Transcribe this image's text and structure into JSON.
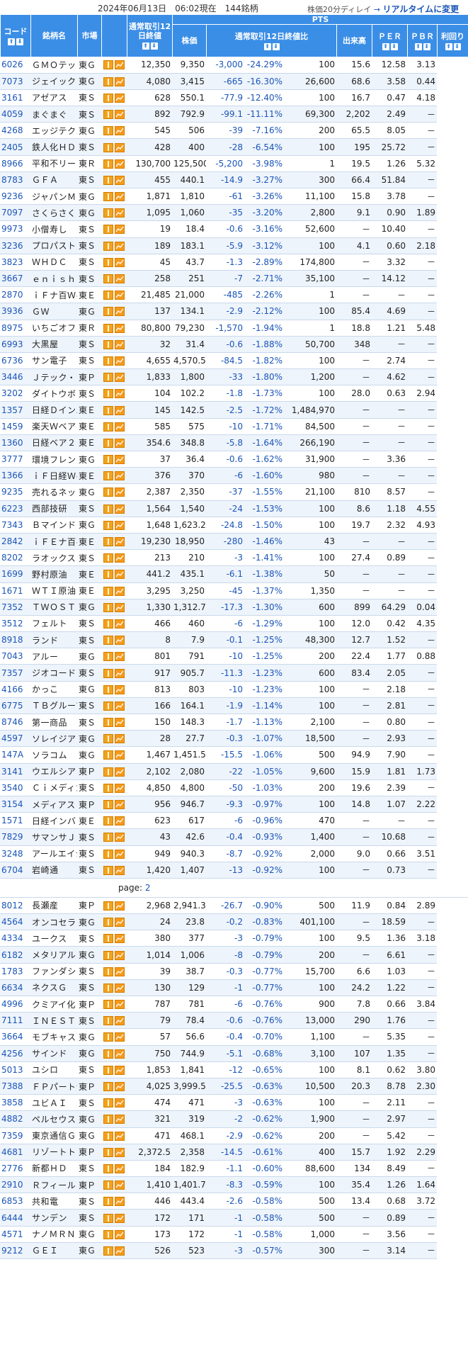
{
  "header": {
    "datetime": "2024年06月13日　06:02現在　144銘柄",
    "delay_text": "株価20分ディレイ",
    "arrow": "→",
    "realtime_link": "リアルタイムに変更"
  },
  "columns": {
    "code": "コード",
    "name": "銘柄名",
    "market": "市場",
    "close_label": "通常取引12日終値",
    "pts": "PTS",
    "price": "株価",
    "ratio_label": "通常取引12日終値比",
    "volume": "出来高",
    "per": "ＰＥＲ",
    "pbr": "ＰＢＲ",
    "yield": "利回り",
    "sort_up": "⬆",
    "sort_down": "⬇"
  },
  "page2_label": "page: ",
  "page2_link": "2",
  "rows": [
    [
      "6026",
      "ＧＭＯテック",
      "東Ｇ",
      "12,350",
      "9,350",
      "-3,000",
      "-24.29%",
      "100",
      "15.6",
      "12.58",
      "3.13"
    ],
    [
      "7073",
      "ジェイック",
      "東Ｇ",
      "4,080",
      "3,415",
      "-665",
      "-16.30%",
      "26,600",
      "68.6",
      "3.58",
      "0.44"
    ],
    [
      "3161",
      "アゼアス",
      "東Ｓ",
      "628",
      "550.1",
      "-77.9",
      "-12.40%",
      "100",
      "16.7",
      "0.47",
      "4.18"
    ],
    [
      "4059",
      "まぐまぐ",
      "東Ｓ",
      "892",
      "792.9",
      "-99.1",
      "-11.11%",
      "69,300",
      "2,202",
      "2.49",
      "－"
    ],
    [
      "4268",
      "エッジテクノ",
      "東Ｇ",
      "545",
      "506",
      "-39",
      "-7.16%",
      "200",
      "65.5",
      "8.05",
      "－"
    ],
    [
      "2405",
      "鉄人化ＨＤ",
      "東Ｓ",
      "428",
      "400",
      "-28",
      "-6.54%",
      "100",
      "195",
      "25.72",
      "－"
    ],
    [
      "8966",
      "平和不リート",
      "東Ｒ",
      "130,700",
      "125,500",
      "-5,200",
      "-3.98%",
      "1",
      "19.5",
      "1.26",
      "5.32"
    ],
    [
      "8783",
      "ＧＦＡ",
      "東Ｓ",
      "455",
      "440.1",
      "-14.9",
      "-3.27%",
      "300",
      "66.4",
      "51.84",
      "－"
    ],
    [
      "9236",
      "ジャパンＭＡ",
      "東Ｇ",
      "1,871",
      "1,810",
      "-61",
      "-3.26%",
      "11,100",
      "15.8",
      "3.78",
      "－"
    ],
    [
      "7097",
      "さくらさく",
      "東Ｇ",
      "1,095",
      "1,060",
      "-35",
      "-3.20%",
      "2,800",
      "9.1",
      "0.90",
      "1.89"
    ],
    [
      "9973",
      "小僧寿し",
      "東Ｓ",
      "19",
      "18.4",
      "-0.6",
      "-3.16%",
      "52,600",
      "－",
      "10.40",
      "－"
    ],
    [
      "3236",
      "プロパスト",
      "東Ｓ",
      "189",
      "183.1",
      "-5.9",
      "-3.12%",
      "100",
      "4.1",
      "0.60",
      "2.18"
    ],
    [
      "3823",
      "ＷＨＤＣ",
      "東Ｓ",
      "45",
      "43.7",
      "-1.3",
      "-2.89%",
      "174,800",
      "－",
      "3.32",
      "－"
    ],
    [
      "3667",
      "ｅｎｉｓｈ",
      "東Ｓ",
      "258",
      "251",
      "-7",
      "-2.71%",
      "35,100",
      "－",
      "14.12",
      "－"
    ],
    [
      "2870",
      "ｉＦナ百Ｗベ",
      "東Ｅ",
      "21,485",
      "21,000",
      "-485",
      "-2.26%",
      "1",
      "－",
      "－",
      "－"
    ],
    [
      "3936",
      "ＧＷ",
      "東Ｇ",
      "137",
      "134.1",
      "-2.9",
      "-2.12%",
      "100",
      "85.4",
      "4.69",
      "－"
    ],
    [
      "8975",
      "いちごオフィ",
      "東Ｒ",
      "80,800",
      "79,230",
      "-1,570",
      "-1.94%",
      "1",
      "18.8",
      "1.21",
      "5.48"
    ],
    [
      "6993",
      "大黒屋",
      "東Ｓ",
      "32",
      "31.4",
      "-0.6",
      "-1.88%",
      "50,700",
      "348",
      "－",
      "－"
    ],
    [
      "6736",
      "サン電子",
      "東Ｓ",
      "4,655",
      "4,570.5",
      "-84.5",
      "-1.82%",
      "100",
      "－",
      "2.74",
      "－"
    ],
    [
      "3446",
      "Ｊテック・Ｃ",
      "東Ｐ",
      "1,833",
      "1,800",
      "-33",
      "-1.80%",
      "1,200",
      "－",
      "4.62",
      "－"
    ],
    [
      "3202",
      "ダイトウボウ",
      "東Ｓ",
      "104",
      "102.2",
      "-1.8",
      "-1.73%",
      "100",
      "28.0",
      "0.63",
      "2.94"
    ],
    [
      "1357",
      "日経Ｄインバ",
      "東Ｅ",
      "145",
      "142.5",
      "-2.5",
      "-1.72%",
      "1,484,970",
      "－",
      "－",
      "－"
    ],
    [
      "1459",
      "楽天Ｗベア",
      "東Ｅ",
      "585",
      "575",
      "-10",
      "-1.71%",
      "84,500",
      "－",
      "－",
      "－"
    ],
    [
      "1360",
      "日経ベア２",
      "東Ｅ",
      "354.6",
      "348.8",
      "-5.8",
      "-1.64%",
      "266,190",
      "－",
      "－",
      "－"
    ],
    [
      "3777",
      "環境フレンド",
      "東Ｇ",
      "37",
      "36.4",
      "-0.6",
      "-1.62%",
      "31,900",
      "－",
      "3.36",
      "－"
    ],
    [
      "1366",
      "ｉＦ日経Ｗベ",
      "東Ｅ",
      "376",
      "370",
      "-6",
      "-1.60%",
      "980",
      "－",
      "－",
      "－"
    ],
    [
      "9235",
      "売れるネット",
      "東Ｇ",
      "2,387",
      "2,350",
      "-37",
      "-1.55%",
      "21,100",
      "810",
      "8.57",
      "－"
    ],
    [
      "6223",
      "西部技研",
      "東Ｓ",
      "1,564",
      "1,540",
      "-24",
      "-1.53%",
      "100",
      "8.6",
      "1.18",
      "4.55"
    ],
    [
      "7343",
      "Ｂマインド",
      "東Ｇ",
      "1,648",
      "1,623.2",
      "-24.8",
      "-1.50%",
      "100",
      "19.7",
      "2.32",
      "4.93"
    ],
    [
      "2842",
      "ｉＦＥナ百ベ",
      "東Ｅ",
      "19,230",
      "18,950",
      "-280",
      "-1.46%",
      "43",
      "－",
      "－",
      "－"
    ],
    [
      "8202",
      "ラオックス",
      "東Ｓ",
      "213",
      "210",
      "-3",
      "-1.41%",
      "100",
      "27.4",
      "0.89",
      "－"
    ],
    [
      "1699",
      "野村原油",
      "東Ｅ",
      "441.2",
      "435.1",
      "-6.1",
      "-1.38%",
      "50",
      "－",
      "－",
      "－"
    ],
    [
      "1671",
      "ＷＴＩ原油",
      "東Ｅ",
      "3,295",
      "3,250",
      "-45",
      "-1.37%",
      "1,350",
      "－",
      "－",
      "－"
    ],
    [
      "7352",
      "ＴＷＯＳＴ",
      "東Ｇ",
      "1,330",
      "1,312.7",
      "-17.3",
      "-1.30%",
      "600",
      "899",
      "64.29",
      "0.04"
    ],
    [
      "3512",
      "フェルト",
      "東Ｓ",
      "466",
      "460",
      "-6",
      "-1.29%",
      "100",
      "12.0",
      "0.42",
      "4.35"
    ],
    [
      "8918",
      "ランド",
      "東Ｓ",
      "8",
      "7.9",
      "-0.1",
      "-1.25%",
      "48,300",
      "12.7",
      "1.52",
      "－"
    ],
    [
      "7043",
      "アルー",
      "東Ｇ",
      "801",
      "791",
      "-10",
      "-1.25%",
      "200",
      "22.4",
      "1.77",
      "0.88"
    ],
    [
      "7357",
      "ジオコード",
      "東Ｓ",
      "917",
      "905.7",
      "-11.3",
      "-1.23%",
      "600",
      "83.4",
      "2.05",
      "－"
    ],
    [
      "4166",
      "かっこ",
      "東Ｇ",
      "813",
      "803",
      "-10",
      "-1.23%",
      "100",
      "－",
      "2.18",
      "－"
    ],
    [
      "6775",
      "ＴＢグループ",
      "東Ｓ",
      "166",
      "164.1",
      "-1.9",
      "-1.14%",
      "100",
      "－",
      "2.81",
      "－"
    ],
    [
      "8746",
      "第一商品",
      "東Ｓ",
      "150",
      "148.3",
      "-1.7",
      "-1.13%",
      "2,100",
      "－",
      "0.80",
      "－"
    ],
    [
      "4597",
      "ソレイジア",
      "東Ｇ",
      "28",
      "27.7",
      "-0.3",
      "-1.07%",
      "18,500",
      "－",
      "2.93",
      "－"
    ],
    [
      "147A",
      "ソラコム",
      "東Ｇ",
      "1,467",
      "1,451.5",
      "-15.5",
      "-1.06%",
      "500",
      "94.9",
      "7.90",
      "－"
    ],
    [
      "3141",
      "ウエルシア",
      "東Ｐ",
      "2,102",
      "2,080",
      "-22",
      "-1.05%",
      "9,600",
      "15.9",
      "1.81",
      "1.73"
    ],
    [
      "3540",
      "Ｃｉメディカ",
      "東Ｓ",
      "4,850",
      "4,800",
      "-50",
      "-1.03%",
      "200",
      "19.6",
      "2.39",
      "－"
    ],
    [
      "3154",
      "メディアス",
      "東Ｐ",
      "956",
      "946.7",
      "-9.3",
      "-0.97%",
      "100",
      "14.8",
      "1.07",
      "2.22"
    ],
    [
      "1571",
      "日経インバ",
      "東Ｅ",
      "623",
      "617",
      "-6",
      "-0.96%",
      "470",
      "－",
      "－",
      "－"
    ],
    [
      "7829",
      "サマンサＪＰ",
      "東Ｓ",
      "43",
      "42.6",
      "-0.4",
      "-0.93%",
      "1,400",
      "－",
      "10.68",
      "－"
    ],
    [
      "3248",
      "アールエイジ",
      "東Ｓ",
      "949",
      "940.3",
      "-8.7",
      "-0.92%",
      "2,000",
      "9.0",
      "0.66",
      "3.51"
    ],
    [
      "6704",
      "岩崎通",
      "東Ｓ",
      "1,420",
      "1,407",
      "-13",
      "-0.92%",
      "100",
      "－",
      "0.73",
      "－"
    ],
    [
      "8012",
      "長瀬産",
      "東Ｐ",
      "2,968",
      "2,941.3",
      "-26.7",
      "-0.90%",
      "500",
      "11.9",
      "0.84",
      "2.89"
    ],
    [
      "4564",
      "オンコセラピ",
      "東Ｇ",
      "24",
      "23.8",
      "-0.2",
      "-0.83%",
      "401,100",
      "－",
      "18.59",
      "－"
    ],
    [
      "4334",
      "ユークス",
      "東Ｓ",
      "380",
      "377",
      "-3",
      "-0.79%",
      "100",
      "9.5",
      "1.36",
      "3.18"
    ],
    [
      "6182",
      "メタリアル",
      "東Ｇ",
      "1,014",
      "1,006",
      "-8",
      "-0.79%",
      "200",
      "－",
      "6.61",
      "－"
    ],
    [
      "1783",
      "ファンダシス",
      "東Ｓ",
      "39",
      "38.7",
      "-0.3",
      "-0.77%",
      "15,700",
      "6.6",
      "1.03",
      "－"
    ],
    [
      "6634",
      "ネクスＧ",
      "東Ｓ",
      "130",
      "129",
      "-1",
      "-0.77%",
      "100",
      "24.2",
      "1.22",
      "－"
    ],
    [
      "4996",
      "クミアイ化",
      "東Ｐ",
      "787",
      "781",
      "-6",
      "-0.76%",
      "900",
      "7.8",
      "0.66",
      "3.84"
    ],
    [
      "7111",
      "ＩＮＥＳＴ",
      "東Ｓ",
      "79",
      "78.4",
      "-0.6",
      "-0.76%",
      "13,000",
      "290",
      "1.76",
      "－"
    ],
    [
      "3664",
      "モブキャスト",
      "東Ｇ",
      "57",
      "56.6",
      "-0.4",
      "-0.70%",
      "1,100",
      "－",
      "5.35",
      "－"
    ],
    [
      "4256",
      "サインド",
      "東Ｇ",
      "750",
      "744.9",
      "-5.1",
      "-0.68%",
      "3,100",
      "107",
      "1.35",
      "－"
    ],
    [
      "5013",
      "ユシロ",
      "東Ｓ",
      "1,853",
      "1,841",
      "-12",
      "-0.65%",
      "100",
      "8.1",
      "0.62",
      "3.80"
    ],
    [
      "7388",
      "ＦＰパートナ",
      "東Ｐ",
      "4,025",
      "3,999.5",
      "-25.5",
      "-0.63%",
      "10,500",
      "20.3",
      "8.78",
      "2.30"
    ],
    [
      "3858",
      "ユビＡＩ",
      "東Ｓ",
      "474",
      "471",
      "-3",
      "-0.63%",
      "100",
      "－",
      "2.11",
      "－"
    ],
    [
      "4882",
      "ペルセウス",
      "東Ｇ",
      "321",
      "319",
      "-2",
      "-0.62%",
      "1,900",
      "－",
      "2.97",
      "－"
    ],
    [
      "7359",
      "東京通信Ｇ",
      "東Ｇ",
      "471",
      "468.1",
      "-2.9",
      "-0.62%",
      "200",
      "－",
      "5.42",
      "－"
    ],
    [
      "4681",
      "リゾートトラ",
      "東Ｐ",
      "2,372.5",
      "2,358",
      "-14.5",
      "-0.61%",
      "400",
      "15.7",
      "1.92",
      "2.29"
    ],
    [
      "2776",
      "新都ＨＤ",
      "東Ｓ",
      "184",
      "182.9",
      "-1.1",
      "-0.60%",
      "88,600",
      "134",
      "8.49",
      "－"
    ],
    [
      "2910",
      "Ｒフィールド",
      "東Ｐ",
      "1,410",
      "1,401.7",
      "-8.3",
      "-0.59%",
      "100",
      "35.4",
      "1.26",
      "1.64"
    ],
    [
      "6853",
      "共和電",
      "東Ｓ",
      "446",
      "443.4",
      "-2.6",
      "-0.58%",
      "500",
      "13.4",
      "0.68",
      "3.72"
    ],
    [
      "6444",
      "サンデン",
      "東Ｓ",
      "172",
      "171",
      "-1",
      "-0.58%",
      "500",
      "－",
      "0.89",
      "－"
    ],
    [
      "4571",
      "ナノＭＲＮＡ",
      "東Ｇ",
      "173",
      "172",
      "-1",
      "-0.58%",
      "1,000",
      "－",
      "3.56",
      "－"
    ],
    [
      "9212",
      "ＧＥＩ",
      "東Ｇ",
      "526",
      "523",
      "-3",
      "-0.57%",
      "300",
      "－",
      "3.14",
      "－"
    ]
  ],
  "page_break_after": 50
}
